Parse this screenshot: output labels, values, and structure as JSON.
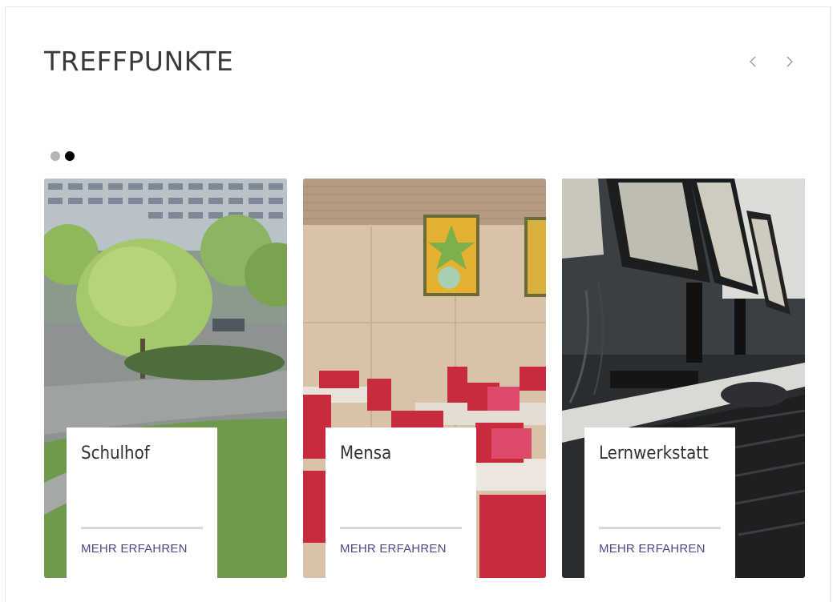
{
  "section": {
    "title": "TREFFPUNKTE",
    "prev_icon": "chevron-left-icon",
    "next_icon": "chevron-right-icon"
  },
  "pagination": {
    "dots": [
      {
        "active": false,
        "color": "#b5b5b5"
      },
      {
        "active": true,
        "color": "#000000"
      }
    ]
  },
  "cards": [
    {
      "title": "Schulhof",
      "link_label": "MEHR ERFAHREN"
    },
    {
      "title": "Mensa",
      "link_label": "MEHR ERFAHREN"
    },
    {
      "title": "Lernwerkstatt",
      "link_label": "MEHR ERFAHREN"
    }
  ],
  "colors": {
    "title": "#3a3a3a",
    "link": "#4a4a8a",
    "divider": "#d9d9d9"
  }
}
